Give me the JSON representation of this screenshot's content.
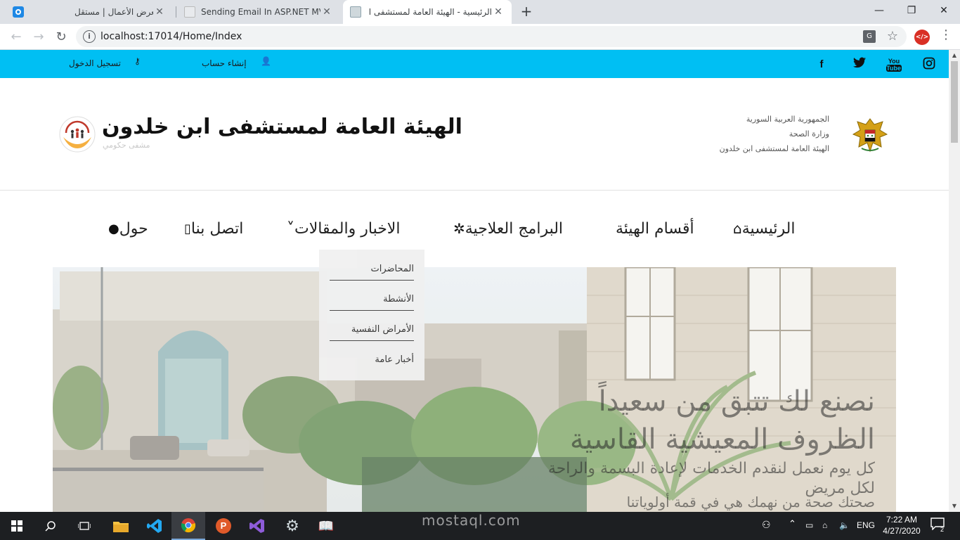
{
  "browser": {
    "tabs": [
      {
        "title": "معرض الأعمال | مستقل",
        "favicon_color": "#1e88e5"
      },
      {
        "title": "Sending Email In ASP.NET MVC",
        "favicon_color": "#e0e0e0"
      },
      {
        "title": "الرئيسية - الهيئة العامة لمستشفى ا",
        "favicon_color": "#cfd8dc"
      }
    ],
    "tab_close": "✕",
    "new_tab": "+",
    "url": "localhost:17014/Home/Index",
    "translate_label": "G",
    "ext_label": "</>",
    "window_controls": {
      "minimize": "—",
      "maximize": "❐",
      "close": "✕"
    }
  },
  "topbar": {
    "login": "تسجيل الدخول",
    "register": "إنشاء حساب",
    "social": [
      "instagram-icon",
      "youtube-icon",
      "twitter-icon",
      "facebook-icon"
    ],
    "accent_color": "#00bff3"
  },
  "header": {
    "ministry_lines": [
      "الجمهورية العربية السورية",
      "وزارة الصحة",
      "الهيئة العامة لمستشفى ابن خلدون"
    ],
    "site_title": "الهيئة العامة لمستشفى ابن خلدون",
    "site_subtitle": "مشفى حكومي"
  },
  "nav": {
    "items": [
      {
        "label": "الرئيسية",
        "icon": "home-icon",
        "glyph": "⌂"
      },
      {
        "label": "أقسام الهيئة",
        "icon": "",
        "glyph": ""
      },
      {
        "label": "البرامج العلاجية",
        "icon": "star-burst-icon",
        "glyph": "✲"
      },
      {
        "label": "الاخبار والمقالات",
        "icon": "chevron-down-icon",
        "glyph": "˅"
      },
      {
        "label": "اتصل بنا",
        "icon": "phone-icon",
        "glyph": "▯"
      },
      {
        "label": "حول",
        "icon": "user-icon",
        "glyph": "●"
      }
    ],
    "dropdown": [
      "المحاضرات",
      "الأنشطة",
      "الأمراض النفسية",
      "أخبار عامة"
    ]
  },
  "hero": {
    "headline_1": "نصنع لك تتبق من سعيداً",
    "headline_2": "الظروف المعيشية القاسية",
    "body_1": "كل يوم نعمل لنقدم الخدمات لإعادة البسمة والراحة",
    "body_2": "لكل مريض",
    "body_3": "صحتك صحة من نهمك هي في قمة أولوياتنا"
  },
  "taskbar": {
    "language": "ENG",
    "time": "7:22 AM",
    "date": "4/27/2020",
    "notifications": "2",
    "watermark": "mostaql.com"
  }
}
